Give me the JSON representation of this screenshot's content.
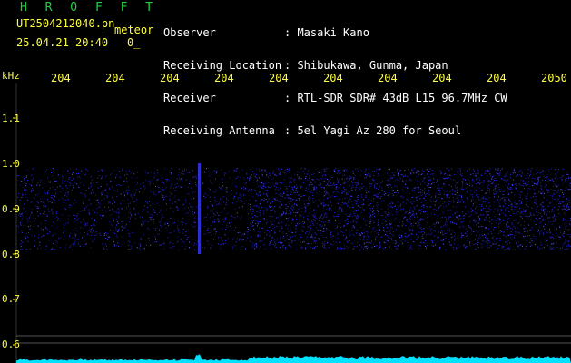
{
  "header": {
    "title": "H R O F F T",
    "file_name": "UT2504212040.pn",
    "tag": "meteor",
    "datetime": "25.04.21 20:40",
    "value": "0_"
  },
  "station": {
    "rows": [
      {
        "label": "Observer",
        "value": ": Masaki Kano"
      },
      {
        "label": "Receiving Location",
        "value": ": Shibukawa, Gunma, Japan"
      },
      {
        "label": "Receiver",
        "value": ": RTL-SDR SDR# 43dB L15 96.7MHz CW"
      },
      {
        "label": "Receiving Antenna",
        "value": ": 5el Yagi Az 280 for Seoul"
      }
    ]
  },
  "chart_data": {
    "type": "heatmap",
    "ylabel": "kHz",
    "y_ticks": [
      "1.1",
      "1.0",
      "0.9",
      "0.8",
      "0.7",
      "0.6"
    ],
    "y_tick_values": [
      1.1,
      1.0,
      0.9,
      0.8,
      0.7,
      0.6
    ],
    "x_ticks": [
      "204",
      "204",
      "204",
      "204",
      "204",
      "204",
      "204",
      "204",
      "204",
      "2050"
    ],
    "ylim": [
      0.58,
      1.16
    ],
    "signal_band": [
      0.8,
      1.0
    ],
    "colors": {
      "background": "#000000",
      "text": "#ffff40",
      "title": "#20d040",
      "noise": "#2a2aff",
      "grid": "#555555",
      "trace": "#00e0ff"
    }
  }
}
